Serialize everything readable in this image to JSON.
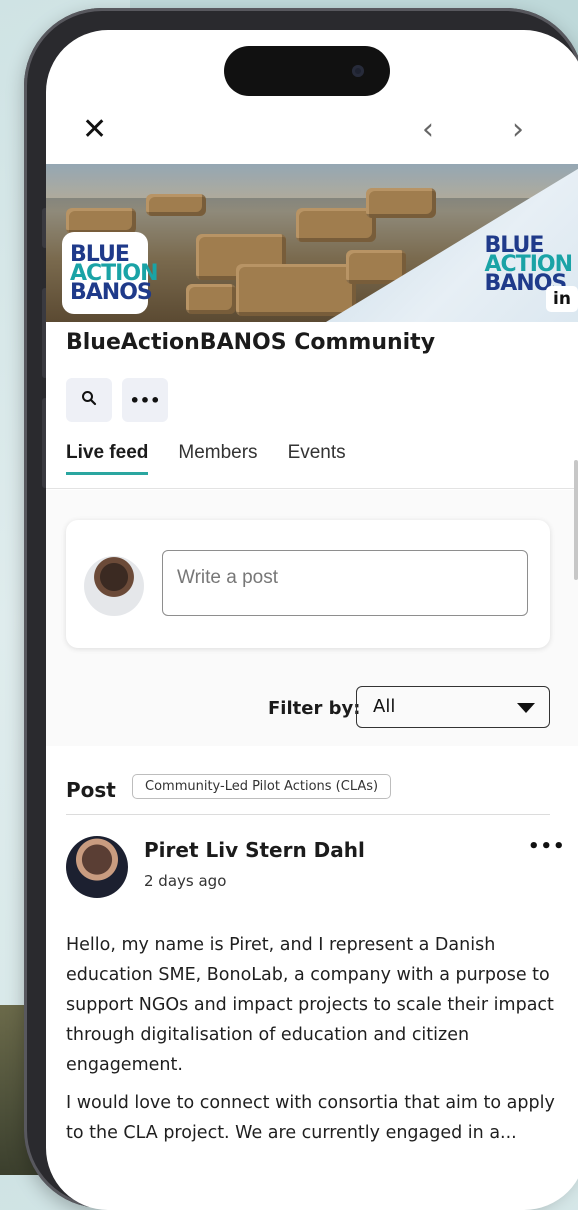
{
  "app": {
    "nav": {
      "close_icon": "close-icon",
      "prev_icon": "chevron-left-icon",
      "next_icon": "chevron-right-icon",
      "close_glyph": "✕",
      "prev_glyph": "‹",
      "next_glyph": "›"
    },
    "banner": {
      "logo_lines": [
        "BLUE",
        "ACTION",
        "BANOS"
      ],
      "logo_colors": [
        "#1f3a8a",
        "#1aa3a6",
        "#1f3a8a"
      ],
      "linkedin_badge": "in"
    },
    "community": {
      "title": "BlueActionBANOS Community",
      "search_icon": "search-icon",
      "search_glyph": "🔍",
      "more_glyph": "•••"
    },
    "tabs": [
      {
        "label": "Live feed",
        "active": true
      },
      {
        "label": "Members",
        "active": false
      },
      {
        "label": "Events",
        "active": false
      }
    ],
    "composer": {
      "placeholder": "Write a post"
    },
    "filter": {
      "label": "Filter by:",
      "selected": "All"
    },
    "post": {
      "type_label": "Post",
      "category": "Community-Led Pilot Actions (CLAs)",
      "author": "Piret Liv Stern Dahl",
      "time": "2 days ago",
      "more_glyph": "•••",
      "paragraphs": [
        "Hello, my name is Piret, and I represent a Danish education SME, BonoLab, a company with a purpose to support NGOs and impact projects to scale their impact through digitalisation of education and citizen engagement.",
        "I would love to connect with consortia that aim to apply to the CLA project. We are currently engaged in a..."
      ]
    },
    "colors": {
      "accent": "#2aa6a0",
      "text": "#1b1b1b"
    }
  }
}
